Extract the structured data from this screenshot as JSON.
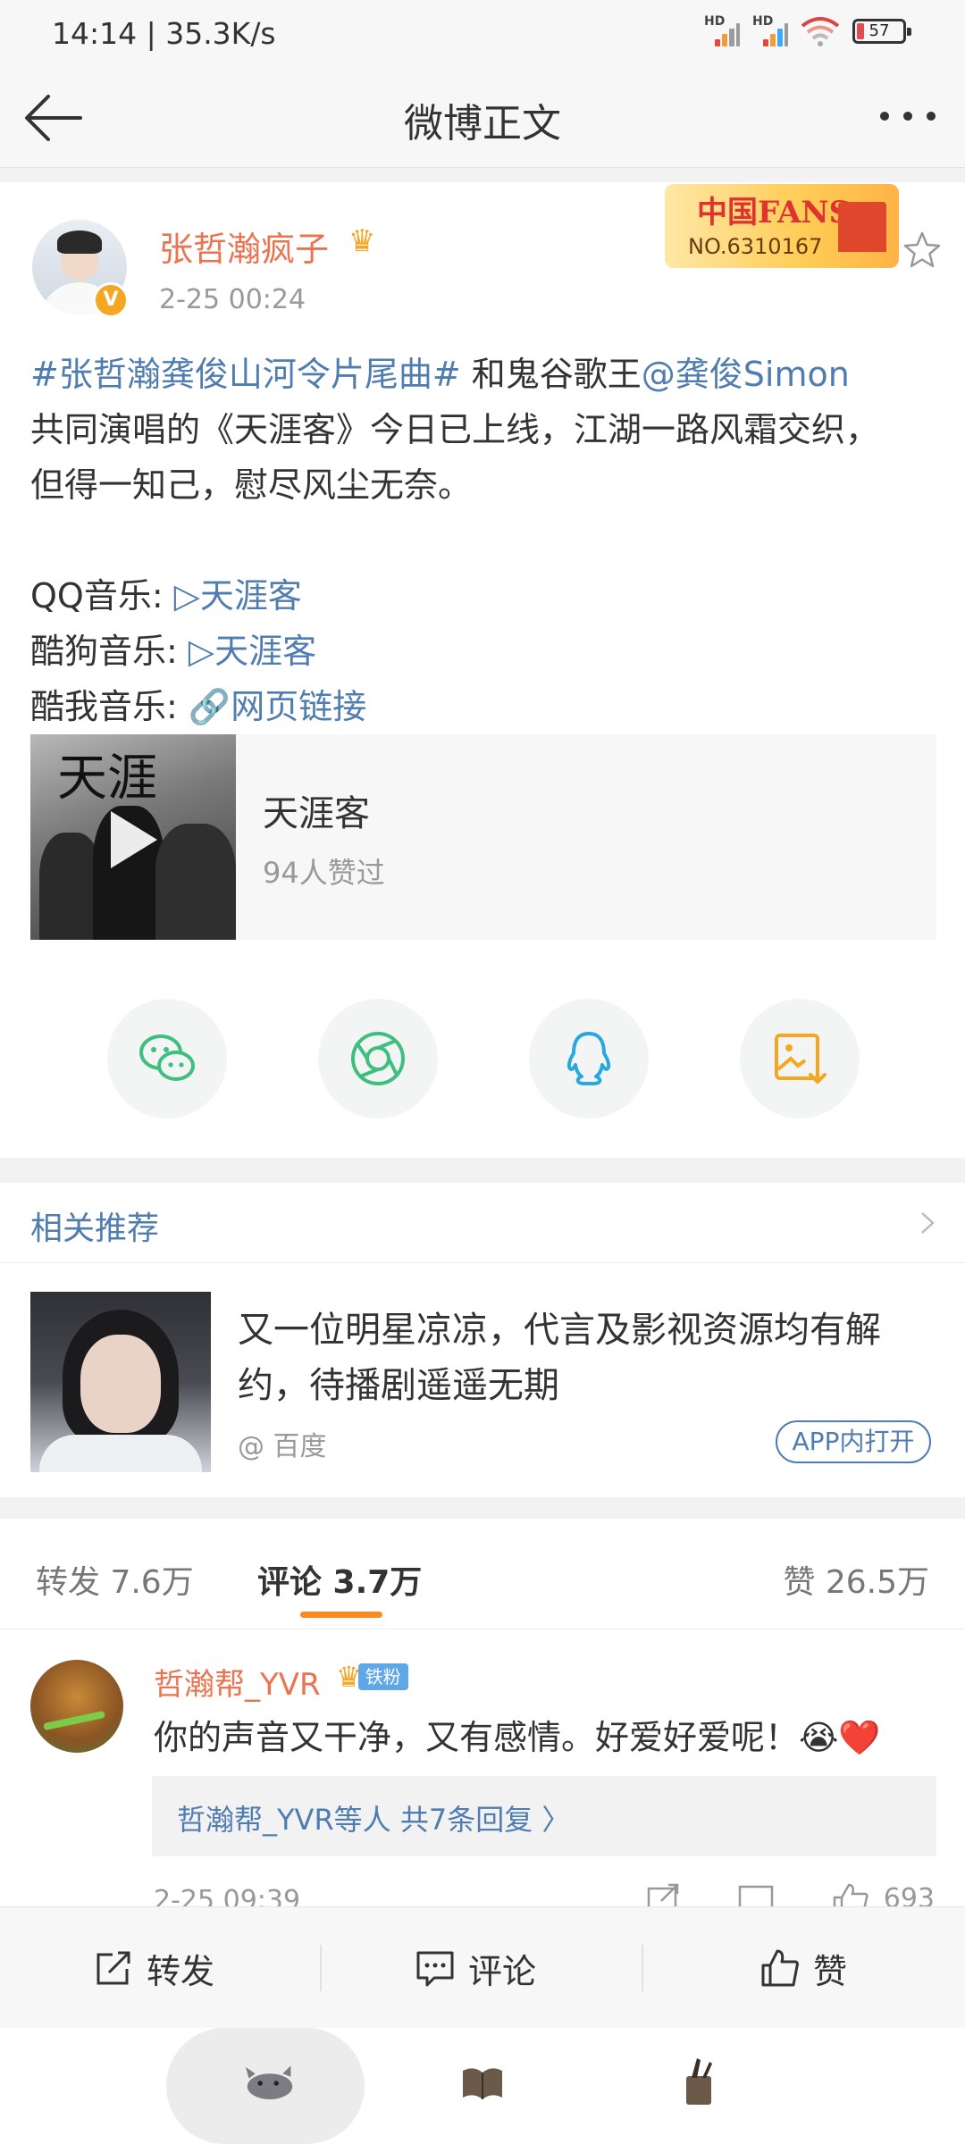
{
  "status_bar": {
    "time_speed": "14:14 | 35.3K/s",
    "hd_label": "HD",
    "battery": "57"
  },
  "nav": {
    "title": "微博正文"
  },
  "post": {
    "username": "张哲瀚疯子",
    "time": "2-25 00:24",
    "fans_badge_title": "中国FANS",
    "fans_badge_no": "NO.6310167",
    "verified_mark": "V",
    "text": {
      "hashtag": "#张哲瀚龚俊山河令片尾曲#",
      "line1_mid": " 和鬼谷歌王",
      "mention": "@龚俊Simon",
      "line2": "共同演唱的《天涯客》今日已上线，江湖一路风霜交织，",
      "line3": "但得一知己，慰尽风尘无奈。",
      "qq_label": "QQ音乐: ",
      "qq_link": "▷天涯客",
      "kugou_label": "酷狗音乐: ",
      "kugou_link": "▷天涯客",
      "kuwo_label": "酷我音乐: ",
      "kuwo_link": "🔗网页链接"
    },
    "music_card": {
      "cover_text": "天涯",
      "title": "天涯客",
      "likes": "94人赞过"
    },
    "share_icons": [
      "wechat-icon",
      "moments-icon",
      "qq-icon",
      "save-image-icon"
    ]
  },
  "recommend": {
    "header": "相关推荐",
    "title": "又一位明星凉凉，代言及影视资源均有解约，待播剧遥遥无期",
    "source": "@ 百度",
    "open_button": "APP内打开"
  },
  "tabs": {
    "repost": "转发 7.6万",
    "comment": "评论 3.7万",
    "like": "赞 26.5万"
  },
  "comment": {
    "user": "哲瀚帮_YVR",
    "badge": "铁粉",
    "text": "你的声音又干净，又有感情。好爱好爱呢！😭❤️",
    "replies": "哲瀚帮_YVR等人  共7条回复 〉",
    "time": "2-25 09:39",
    "likes": "693"
  },
  "action_bar": {
    "repost": "转发",
    "comment": "评论",
    "like": "赞"
  },
  "colors": {
    "accent_orange": "#eb7350",
    "link_blue": "#507daf",
    "tab_underline": "#f98a1f",
    "wechat_green": "#3fbf7f",
    "qq_blue": "#29a7e1",
    "save_orange": "#f5a623"
  }
}
